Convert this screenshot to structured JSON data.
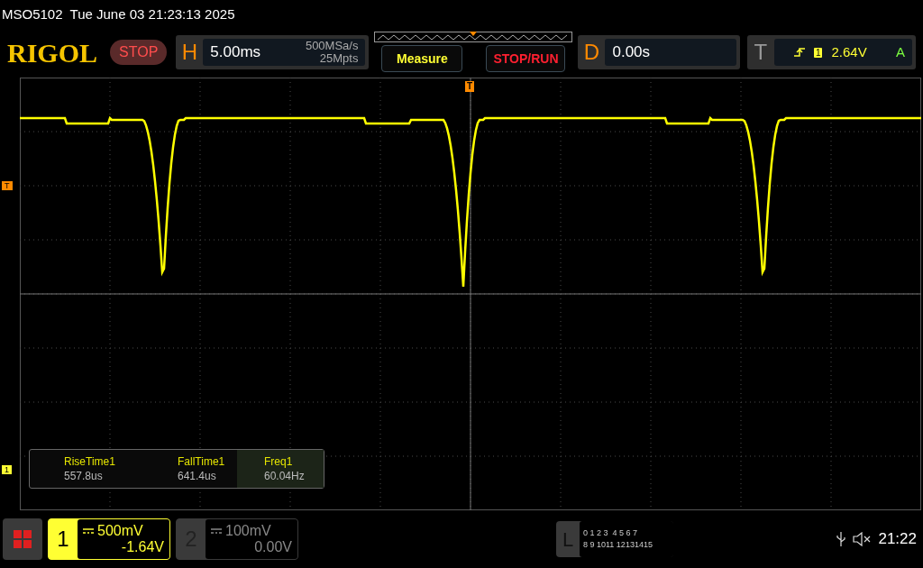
{
  "header": {
    "model": "MSO5102",
    "datetime": "Tue June 03 21:23:13 2025"
  },
  "toolbar": {
    "logo": "RIGOL",
    "run_state": "STOP",
    "horizontal": {
      "label": "H",
      "timebase": "5.00ms",
      "sample_rate": "500MSa/s",
      "memory_depth": "25Mpts"
    },
    "buttons": [
      "Measure",
      "STOP/RUN"
    ],
    "delay": {
      "label": "D",
      "value": "0.00s"
    },
    "trigger": {
      "label": "T",
      "source": "1",
      "level": "2.64V",
      "mode": "A"
    }
  },
  "plot": {
    "trigger_position_marker": "T",
    "trigger_level_marker": "T",
    "channel_marker": "1"
  },
  "measurements": [
    {
      "name": "RiseTime1",
      "value": "557.8us",
      "selected": false
    },
    {
      "name": "FallTime1",
      "value": "641.4us",
      "selected": false
    },
    {
      "name": "Freq1",
      "value": "60.04Hz",
      "selected": true
    }
  ],
  "channels": [
    {
      "number": "1",
      "scale": "500mV",
      "offset": "-1.64V",
      "selected": true
    },
    {
      "number": "2",
      "scale": "100mV",
      "offset": "0.00V",
      "selected": false
    }
  ],
  "logic": {
    "label": "L",
    "rows": [
      "0 1 2 3  4 5 6 7",
      "8 9 1011 12131415"
    ]
  },
  "status": {
    "time": "21:22"
  }
}
